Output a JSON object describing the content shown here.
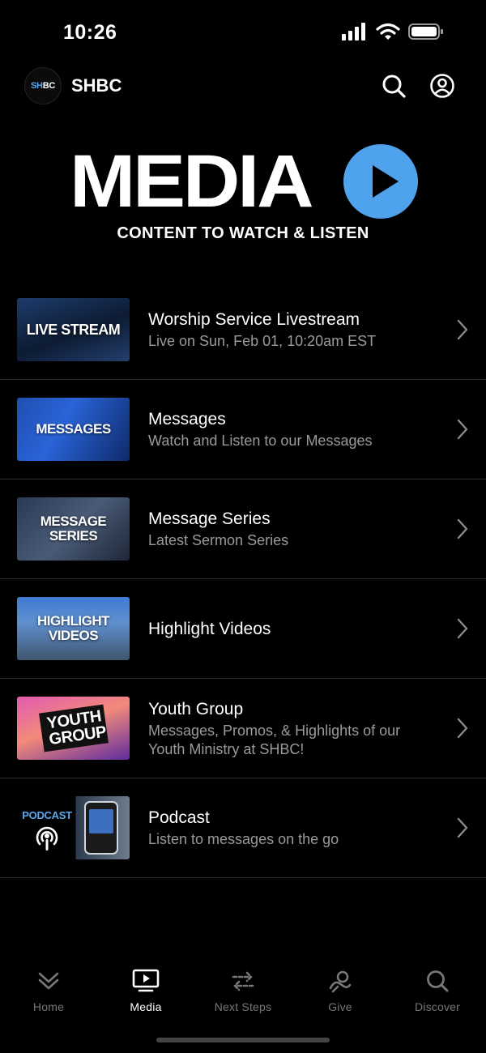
{
  "status_bar": {
    "time": "10:26"
  },
  "header": {
    "logo_text": "SHBC",
    "title": "SHBC",
    "icons": [
      "search-icon",
      "account-icon"
    ]
  },
  "hero": {
    "title": "MEDIA",
    "subtitle": "CONTENT TO WATCH & LISTEN",
    "accent": "#4fa3ec"
  },
  "media_items": [
    {
      "title": "Worship Service Livestream",
      "subtitle": "Live on Sun, Feb 01, 10:20am EST",
      "thumb_label": "LIVE STREAM"
    },
    {
      "title": "Messages",
      "subtitle": "Watch and Listen to our Messages",
      "thumb_label": "MESSAGES"
    },
    {
      "title": "Message Series",
      "subtitle": "Latest Sermon Series",
      "thumb_label": "MESSAGE SERIES"
    },
    {
      "title": "Highlight Videos",
      "subtitle": "",
      "thumb_label": "HIGHLIGHT VIDEOS"
    },
    {
      "title": "Youth Group",
      "subtitle": "Messages, Promos, & Highlights of our Youth Ministry at SHBC!",
      "thumb_label": "YOUTH GROUP"
    },
    {
      "title": "Podcast",
      "subtitle": "Listen to messages on the go",
      "thumb_label": "PODCAST"
    }
  ],
  "tabs": [
    {
      "label": "Home",
      "icon": "chevrons-down-icon",
      "active": false
    },
    {
      "label": "Media",
      "icon": "tv-play-icon",
      "active": true
    },
    {
      "label": "Next Steps",
      "icon": "arrows-swap-icon",
      "active": false
    },
    {
      "label": "Give",
      "icon": "give-icon",
      "active": false
    },
    {
      "label": "Discover",
      "icon": "search-icon",
      "active": false
    }
  ]
}
